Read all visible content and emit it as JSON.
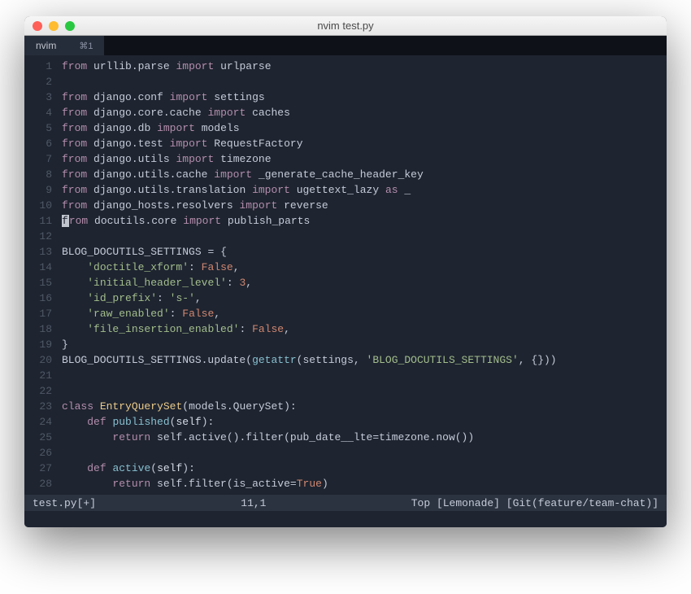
{
  "window": {
    "title": "nvim test.py"
  },
  "tab": {
    "label": "nvim",
    "shortcut": "⌘1"
  },
  "code": {
    "lines": [
      {
        "n": 1,
        "tokens": [
          [
            "kw",
            "from"
          ],
          [
            "sp",
            " "
          ],
          [
            "mod",
            "urllib.parse"
          ],
          [
            "sp",
            " "
          ],
          [
            "imp",
            "import"
          ],
          [
            "sp",
            " "
          ],
          [
            "ident",
            "urlparse"
          ]
        ]
      },
      {
        "n": 2,
        "tokens": []
      },
      {
        "n": 3,
        "tokens": [
          [
            "kw",
            "from"
          ],
          [
            "sp",
            " "
          ],
          [
            "mod",
            "django.conf"
          ],
          [
            "sp",
            " "
          ],
          [
            "imp",
            "import"
          ],
          [
            "sp",
            " "
          ],
          [
            "ident",
            "settings"
          ]
        ]
      },
      {
        "n": 4,
        "tokens": [
          [
            "kw",
            "from"
          ],
          [
            "sp",
            " "
          ],
          [
            "mod",
            "django.core.cache"
          ],
          [
            "sp",
            " "
          ],
          [
            "imp",
            "import"
          ],
          [
            "sp",
            " "
          ],
          [
            "ident",
            "caches"
          ]
        ]
      },
      {
        "n": 5,
        "tokens": [
          [
            "kw",
            "from"
          ],
          [
            "sp",
            " "
          ],
          [
            "mod",
            "django.db"
          ],
          [
            "sp",
            " "
          ],
          [
            "imp",
            "import"
          ],
          [
            "sp",
            " "
          ],
          [
            "ident",
            "models"
          ]
        ]
      },
      {
        "n": 6,
        "tokens": [
          [
            "kw",
            "from"
          ],
          [
            "sp",
            " "
          ],
          [
            "mod",
            "django.test"
          ],
          [
            "sp",
            " "
          ],
          [
            "imp",
            "import"
          ],
          [
            "sp",
            " "
          ],
          [
            "ident",
            "RequestFactory"
          ]
        ]
      },
      {
        "n": 7,
        "tokens": [
          [
            "kw",
            "from"
          ],
          [
            "sp",
            " "
          ],
          [
            "mod",
            "django.utils"
          ],
          [
            "sp",
            " "
          ],
          [
            "imp",
            "import"
          ],
          [
            "sp",
            " "
          ],
          [
            "ident",
            "timezone"
          ]
        ]
      },
      {
        "n": 8,
        "tokens": [
          [
            "kw",
            "from"
          ],
          [
            "sp",
            " "
          ],
          [
            "mod",
            "django.utils.cache"
          ],
          [
            "sp",
            " "
          ],
          [
            "imp",
            "import"
          ],
          [
            "sp",
            " "
          ],
          [
            "ident",
            "_generate_cache_header_key"
          ]
        ]
      },
      {
        "n": 9,
        "tokens": [
          [
            "kw",
            "from"
          ],
          [
            "sp",
            " "
          ],
          [
            "mod",
            "django.utils.translation"
          ],
          [
            "sp",
            " "
          ],
          [
            "imp",
            "import"
          ],
          [
            "sp",
            " "
          ],
          [
            "ident",
            "ugettext_lazy"
          ],
          [
            "sp",
            " "
          ],
          [
            "kw",
            "as"
          ],
          [
            "sp",
            " "
          ],
          [
            "ident",
            "_"
          ]
        ]
      },
      {
        "n": 10,
        "tokens": [
          [
            "kw",
            "from"
          ],
          [
            "sp",
            " "
          ],
          [
            "mod",
            "django_hosts.resolvers"
          ],
          [
            "sp",
            " "
          ],
          [
            "imp",
            "import"
          ],
          [
            "sp",
            " "
          ],
          [
            "ident",
            "reverse"
          ]
        ]
      },
      {
        "n": 11,
        "tokens": [
          [
            "cursor",
            "f"
          ],
          [
            "kw",
            "rom"
          ],
          [
            "sp",
            " "
          ],
          [
            "mod",
            "docutils.core"
          ],
          [
            "sp",
            " "
          ],
          [
            "imp",
            "import"
          ],
          [
            "sp",
            " "
          ],
          [
            "ident",
            "publish_parts"
          ]
        ]
      },
      {
        "n": 12,
        "tokens": []
      },
      {
        "n": 13,
        "tokens": [
          [
            "ident",
            "BLOG_DOCUTILS_SETTINGS"
          ],
          [
            "sp",
            " "
          ],
          [
            "eq",
            "="
          ],
          [
            "sp",
            " "
          ],
          [
            "punct",
            "{"
          ]
        ]
      },
      {
        "n": 14,
        "tokens": [
          [
            "sp",
            "    "
          ],
          [
            "str",
            "'doctitle_xform'"
          ],
          [
            "punct",
            ":"
          ],
          [
            "sp",
            " "
          ],
          [
            "const",
            "False"
          ],
          [
            "punct",
            ","
          ]
        ]
      },
      {
        "n": 15,
        "tokens": [
          [
            "sp",
            "    "
          ],
          [
            "str",
            "'initial_header_level'"
          ],
          [
            "punct",
            ":"
          ],
          [
            "sp",
            " "
          ],
          [
            "num",
            "3"
          ],
          [
            "punct",
            ","
          ]
        ]
      },
      {
        "n": 16,
        "tokens": [
          [
            "sp",
            "    "
          ],
          [
            "str",
            "'id_prefix'"
          ],
          [
            "punct",
            ":"
          ],
          [
            "sp",
            " "
          ],
          [
            "str",
            "'s-'"
          ],
          [
            "punct",
            ","
          ]
        ]
      },
      {
        "n": 17,
        "tokens": [
          [
            "sp",
            "    "
          ],
          [
            "str",
            "'raw_enabled'"
          ],
          [
            "punct",
            ":"
          ],
          [
            "sp",
            " "
          ],
          [
            "const",
            "False"
          ],
          [
            "punct",
            ","
          ]
        ]
      },
      {
        "n": 18,
        "tokens": [
          [
            "sp",
            "    "
          ],
          [
            "str",
            "'file_insertion_enabled'"
          ],
          [
            "punct",
            ":"
          ],
          [
            "sp",
            " "
          ],
          [
            "const",
            "False"
          ],
          [
            "punct",
            ","
          ]
        ]
      },
      {
        "n": 19,
        "tokens": [
          [
            "punct",
            "}"
          ]
        ]
      },
      {
        "n": 20,
        "tokens": [
          [
            "ident",
            "BLOG_DOCUTILS_SETTINGS.update"
          ],
          [
            "punct",
            "("
          ],
          [
            "func",
            "getattr"
          ],
          [
            "punct",
            "("
          ],
          [
            "ident",
            "settings"
          ],
          [
            "punct",
            ","
          ],
          [
            "sp",
            " "
          ],
          [
            "str",
            "'BLOG_DOCUTILS_SETTINGS'"
          ],
          [
            "punct",
            ","
          ],
          [
            "sp",
            " "
          ],
          [
            "punct",
            "{}))"
          ]
        ]
      },
      {
        "n": 21,
        "tokens": []
      },
      {
        "n": 22,
        "tokens": []
      },
      {
        "n": 23,
        "tokens": [
          [
            "kw",
            "class"
          ],
          [
            "sp",
            " "
          ],
          [
            "clsname",
            "EntryQuerySet"
          ],
          [
            "punct",
            "("
          ],
          [
            "ident",
            "models.QuerySet"
          ],
          [
            "punct",
            "):"
          ]
        ]
      },
      {
        "n": 24,
        "tokens": [
          [
            "sp",
            "    "
          ],
          [
            "kw",
            "def"
          ],
          [
            "sp",
            " "
          ],
          [
            "defname",
            "published"
          ],
          [
            "punct",
            "("
          ],
          [
            "self",
            "self"
          ],
          [
            "punct",
            "):"
          ]
        ]
      },
      {
        "n": 25,
        "tokens": [
          [
            "sp",
            "        "
          ],
          [
            "kw",
            "return"
          ],
          [
            "sp",
            " "
          ],
          [
            "ident",
            "self.active().filter"
          ],
          [
            "punct",
            "("
          ],
          [
            "ident",
            "pub_date__lte"
          ],
          [
            "eq",
            "="
          ],
          [
            "ident",
            "timezone.now"
          ],
          [
            "punct",
            "())"
          ]
        ]
      },
      {
        "n": 26,
        "tokens": []
      },
      {
        "n": 27,
        "tokens": [
          [
            "sp",
            "    "
          ],
          [
            "kw",
            "def"
          ],
          [
            "sp",
            " "
          ],
          [
            "defname",
            "active"
          ],
          [
            "punct",
            "("
          ],
          [
            "self",
            "self"
          ],
          [
            "punct",
            "):"
          ]
        ]
      },
      {
        "n": 28,
        "tokens": [
          [
            "sp",
            "        "
          ],
          [
            "kw",
            "return"
          ],
          [
            "sp",
            " "
          ],
          [
            "ident",
            "self.filter"
          ],
          [
            "punct",
            "("
          ],
          [
            "ident",
            "is_active"
          ],
          [
            "eq",
            "="
          ],
          [
            "const",
            "True"
          ],
          [
            "punct",
            ")"
          ]
        ]
      }
    ]
  },
  "status": {
    "filename": "test.py[+]",
    "position": "11,1",
    "right": "Top  [Lemonade]  [Git(feature/team-chat)]"
  },
  "colors": {
    "bg": "#1e2430",
    "keyword": "#b48ead",
    "string": "#a3be8c",
    "number": "#d08770",
    "function": "#88c0d0",
    "class": "#ebcb8b",
    "text": "#c5cbd8"
  }
}
